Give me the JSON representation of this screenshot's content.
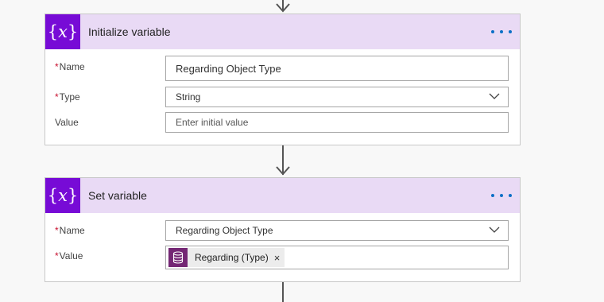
{
  "flow": {
    "steps": [
      {
        "title": "Initialize variable",
        "icon": "variable-braces-icon",
        "fields": {
          "name": {
            "label": "Name",
            "value": "Regarding Object Type",
            "required": true
          },
          "type": {
            "label": "Type",
            "value": "String",
            "required": true
          },
          "value": {
            "label": "Value",
            "placeholder": "Enter initial value",
            "required": false
          }
        }
      },
      {
        "title": "Set variable",
        "icon": "variable-braces-icon",
        "fields": {
          "name": {
            "label": "Name",
            "value": "Regarding Object Type",
            "required": true
          },
          "value": {
            "label": "Value",
            "required": true,
            "token": {
              "label": "Regarding (Type)",
              "icon": "database-icon",
              "remove": "×"
            }
          }
        }
      }
    ],
    "required_marker": "*"
  },
  "colors": {
    "header_bg": "#e9daf5",
    "icon_bg": "#770bd6",
    "token_icon_bg": "#742774",
    "more_dots": "#0b6fc7",
    "required_star": "#c8102e"
  }
}
